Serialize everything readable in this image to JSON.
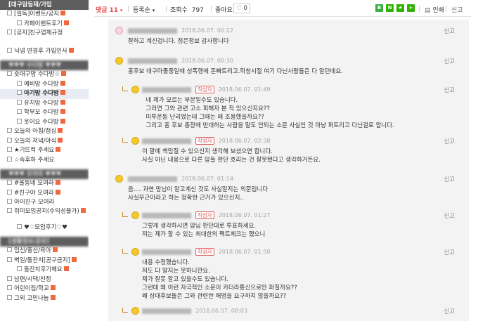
{
  "sidebar": {
    "sections": [
      {
        "head": "[대구맘등재/가입",
        "items": [
          {
            "label": "[필독]이벤트/공지",
            "sub": false,
            "new": true
          },
          {
            "label": "카페이벤트후기",
            "sub": true,
            "new": true
          },
          {
            "label": "[공지]친구업체규정",
            "sub": false,
            "new": false
          }
        ]
      },
      {
        "gap": true,
        "items": [
          {
            "label": "닉넴 변경후 가입인사",
            "sub": false,
            "new": true
          }
        ]
      },
      {
        "head": "♥♥♥ 수다방 ♥♥♥",
        "items": [
          {
            "label": "숏대구맘 수다방☆",
            "sub": false,
            "new": true
          },
          {
            "label": "예비맘 수다방",
            "sub": true,
            "new": true
          },
          {
            "label": "아기맘 수다방",
            "sub": true,
            "new": true,
            "bold": true,
            "active": true
          },
          {
            "label": "유치맘 수다방",
            "sub": true,
            "new": true
          },
          {
            "label": "학부모 수다방",
            "sub": true,
            "new": true
          },
          {
            "label": "옷어요 수다방",
            "sub": true,
            "new": true
          },
          {
            "label": "오늘의 아침/점심",
            "sub": false,
            "new": true
          },
          {
            "label": "오늘의 저녁/야식",
            "sub": false,
            "new": true
          },
          {
            "label": "★기뜨컥 주세요",
            "sub": false,
            "new": true
          },
          {
            "label": "☆속후하 주세요",
            "sub": false,
            "new": false
          }
        ]
      },
      {
        "head": "♥♥♥ 모여라 ♥♥♥",
        "items": [
          {
            "label": "#울동네 모여라",
            "sub": false,
            "new": true
          },
          {
            "label": "#친구야 모여라",
            "sub": false,
            "new": true
          },
          {
            "label": "아이친구 모여라",
            "sub": false,
            "new": false
          },
          {
            "label": "취미모임공지(수익성불가)",
            "sub": false,
            "new": true,
            "two": true
          },
          {
            "label": "♥♡모임후기♡♥",
            "sub": true,
            "new": false
          }
        ]
      },
      {
        "head": "[생활정보/공유]",
        "items": [
          {
            "label": "임신/출산/육아",
            "sub": false,
            "new": true
          },
          {
            "label": "벽일/돌잔치[공구금지]",
            "sub": false,
            "new": true
          },
          {
            "label": "돌잔치후기해요",
            "sub": true,
            "new": true
          },
          {
            "label": "남편/시댁/친정",
            "sub": false,
            "new": false
          },
          {
            "label": "어린이집/학교",
            "sub": false,
            "new": true
          },
          {
            "label": "그외 고민나눔",
            "sub": false,
            "new": true
          }
        ]
      }
    ]
  },
  "toolbar": {
    "comment_label": "댓글",
    "comment_count": "11",
    "sort_label": "등록순",
    "view_label": "조회수",
    "view_count": "797",
    "like_label": "좋아요",
    "like_count": "0",
    "print_label": "인쇄",
    "report_label": "신고",
    "share_icons": [
      {
        "name": "band-share-icon",
        "color": "#3cb043",
        "glyph": "B"
      },
      {
        "name": "naver-share-icon",
        "color": "#2db400",
        "glyph": "N"
      },
      {
        "name": "bookmark-share-icon",
        "color": "#2db400",
        "glyph": "★"
      },
      {
        "name": "add-share-icon",
        "color": "#2db400",
        "glyph": "+"
      }
    ]
  },
  "comments": [
    {
      "date": "2018.06.07. 00:22",
      "writer": false,
      "reply": false,
      "avatar": "pink",
      "body": "잘하고 계신겁니다. 정은정보 감사합니다",
      "report": "신고"
    },
    {
      "date": "2018.06.07. 00:30",
      "writer": false,
      "reply": false,
      "avatar": "yellow",
      "body": "홍후보 대구마졸중일때 성폭행에 돈빠트리고.학창시절 여기 다닌사람들은 다 알던데요.",
      "report": "신고"
    },
    {
      "date": "2018.06.07. 01:49",
      "writer": true,
      "reply": true,
      "avatar": "yellow",
      "body": "  네 제가 모르는 부분일수도 있습니다.\n  그러면 그와 관련 고소 피해자 본 적 있으신지요??\n  미투운동 난리였는데 그때는 왜 조용했을까요??\n  그리고 홍 후보 총장에 반대하는 사람을 말도 안되는 소문 사실인 것 마냥 퍼트리고 다닌걸로 압니다.",
      "report": "신고"
    },
    {
      "date": "2018.06.07. 02:38",
      "writer": true,
      "reply": true,
      "avatar": "yellow",
      "body": "이 말에 책임질 수 있으신지 생각해 보셨으면 합니다.\n사실 아닌 내용으로 다른 맘들 판단 흐리는 건 잘못됐다고 생각하거든요.",
      "report": "신고"
    },
    {
      "date": "2018.06.07. 01:14",
      "writer": false,
      "reply": false,
      "avatar": "yellow",
      "body": "음.... 과연 맘님이 알고계신 것도 사실일지는 의문입니다\n사실무근이라고 하는 정확한 근거가 있으신지..",
      "report": "신고"
    },
    {
      "date": "2018.06.07. 01:27",
      "writer": true,
      "reply": true,
      "avatar": "yellow",
      "body": "그렇게 생각하시면 맘님 판단대로 투표하세요.\n저는 제가 할 수 있는 최대한의 팩트체크는 했으니",
      "report": "신고"
    },
    {
      "date": "2018.06.07. 01:50",
      "writer": true,
      "reply": true,
      "avatar": "yellow",
      "body": "내용 수정했습니다.\n저도 다 알지는 못하니깐요.\n제가 잘못 알고 있을수도 있습니다.\n그런데 왜 이런 자극적인 소문이 카더라통신으로만 퍼질까요??\n왜 상대후보들은 그와 관련한 해명을 요구하지 않을까요??",
      "report": "신고"
    },
    {
      "date": "2018.06.07. 08:03",
      "writer": false,
      "reply": true,
      "avatar": "yellow",
      "body": "",
      "report": "신고"
    }
  ]
}
